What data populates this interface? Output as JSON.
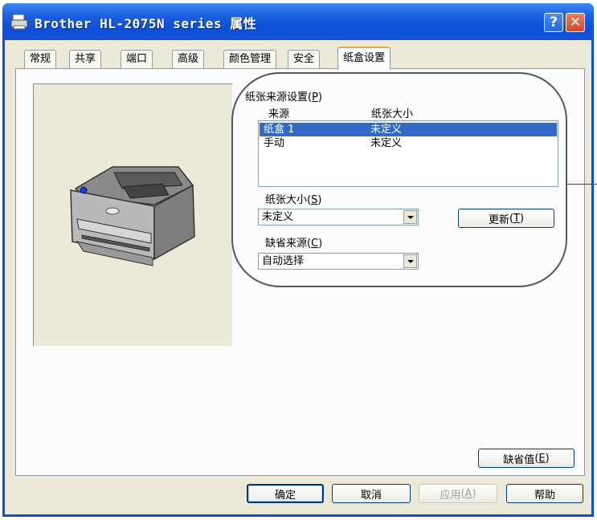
{
  "window": {
    "title": "Brother HL-2075N series 属性",
    "help_label": "?",
    "close_label": "✕"
  },
  "tabs": [
    {
      "label": "常规"
    },
    {
      "label": "共享"
    },
    {
      "label": "端口"
    },
    {
      "label": "高级"
    },
    {
      "label": "颜色管理"
    },
    {
      "label": "安全"
    },
    {
      "label": "纸盒设置"
    }
  ],
  "active_tab": "纸盒设置",
  "source_settings": {
    "group_label": "纸张来源设置",
    "group_hotkey": "P",
    "col_source": "来源",
    "col_size": "纸张大小",
    "rows": [
      {
        "source": "纸盒 1",
        "size": "未定义",
        "selected": true
      },
      {
        "source": "手动",
        "size": "未定义",
        "selected": false
      }
    ]
  },
  "paper_size": {
    "label": "纸张大小",
    "hotkey": "S",
    "value": "未定义"
  },
  "default_source": {
    "label": "缺省来源",
    "hotkey": "C",
    "value": "自动选择"
  },
  "buttons": {
    "update_label": "更新",
    "update_hotkey": "T",
    "defaults_label": "缺省值",
    "defaults_hotkey": "E",
    "ok": "确定",
    "cancel": "取消",
    "apply_label": "应用",
    "apply_hotkey": "A",
    "help": "帮助"
  }
}
